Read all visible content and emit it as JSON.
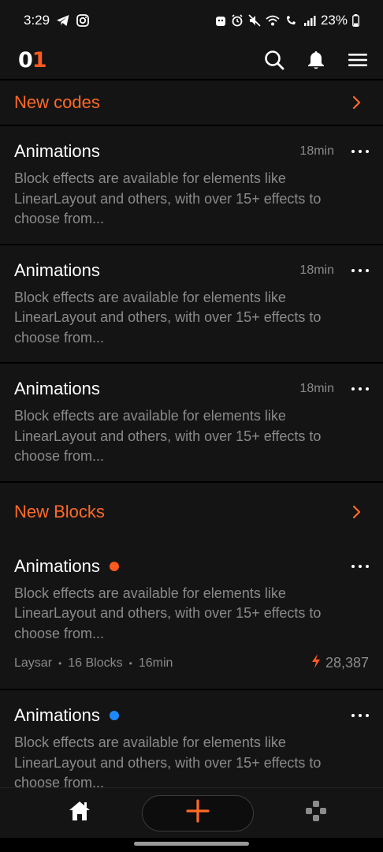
{
  "status": {
    "time": "3:29",
    "battery": "23%"
  },
  "app": {
    "logo_part1": "0",
    "logo_part2": "1"
  },
  "sections": {
    "codes": {
      "title": "New codes",
      "items": [
        {
          "title": "Animations",
          "time": "18min",
          "desc": "Block effects are available for elements like LinearLayout and others, with over 15+ effects to choose from..."
        },
        {
          "title": "Animations",
          "time": "18min",
          "desc": "Block effects are available for elements like LinearLayout and others, with over 15+ effects to choose from..."
        },
        {
          "title": "Animations",
          "time": "18min",
          "desc": "Block effects are available for elements like LinearLayout and others, with over 15+ effects to choose from..."
        }
      ]
    },
    "blocks": {
      "title": "New Blocks",
      "items": [
        {
          "title": "Animations",
          "dot_color": "#ff5a1f",
          "desc": "Block effects are available for elements like LinearLayout and others, with over 15+ effects to choose from...",
          "author": "Laysar",
          "count": "16 Blocks",
          "time": "16min",
          "score": "28,387"
        },
        {
          "title": "Animations",
          "dot_color": "#1e88ff",
          "desc": "Block effects are available for elements like LinearLayout and others, with over 15+ effects to choose from..."
        }
      ]
    }
  },
  "colors": {
    "accent": "#ff6a26",
    "background": "#000000",
    "card": "#141414",
    "muted_text": "#8a8a8a"
  },
  "icons": {
    "telegram": "telegram-icon",
    "instagram": "instagram-icon",
    "search": "search-icon",
    "bell": "bell-icon",
    "menu": "menu-icon",
    "chevron": "chevron-right-icon",
    "more": "more-horizontal-icon",
    "bolt": "lightning-icon",
    "home": "home-icon",
    "add": "plus-icon",
    "game": "gamepad-icon"
  }
}
